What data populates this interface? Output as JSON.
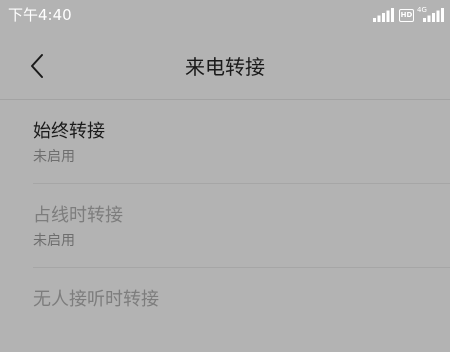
{
  "status_bar": {
    "time": "下午4:40",
    "hd_label": "HD",
    "network_label": "4G"
  },
  "header": {
    "title": "来电转接"
  },
  "settings": [
    {
      "title": "始终转接",
      "status": "未启用",
      "enabled": true
    },
    {
      "title": "占线时转接",
      "status": "未启用",
      "enabled": false
    },
    {
      "title": "无人接听时转接",
      "status": "",
      "enabled": false
    }
  ],
  "colors": {
    "background": "#b3b3b3",
    "primary_text": "#1a1a1a",
    "disabled_text": "#7d7d7d",
    "secondary_text": "#6e6e6e"
  }
}
